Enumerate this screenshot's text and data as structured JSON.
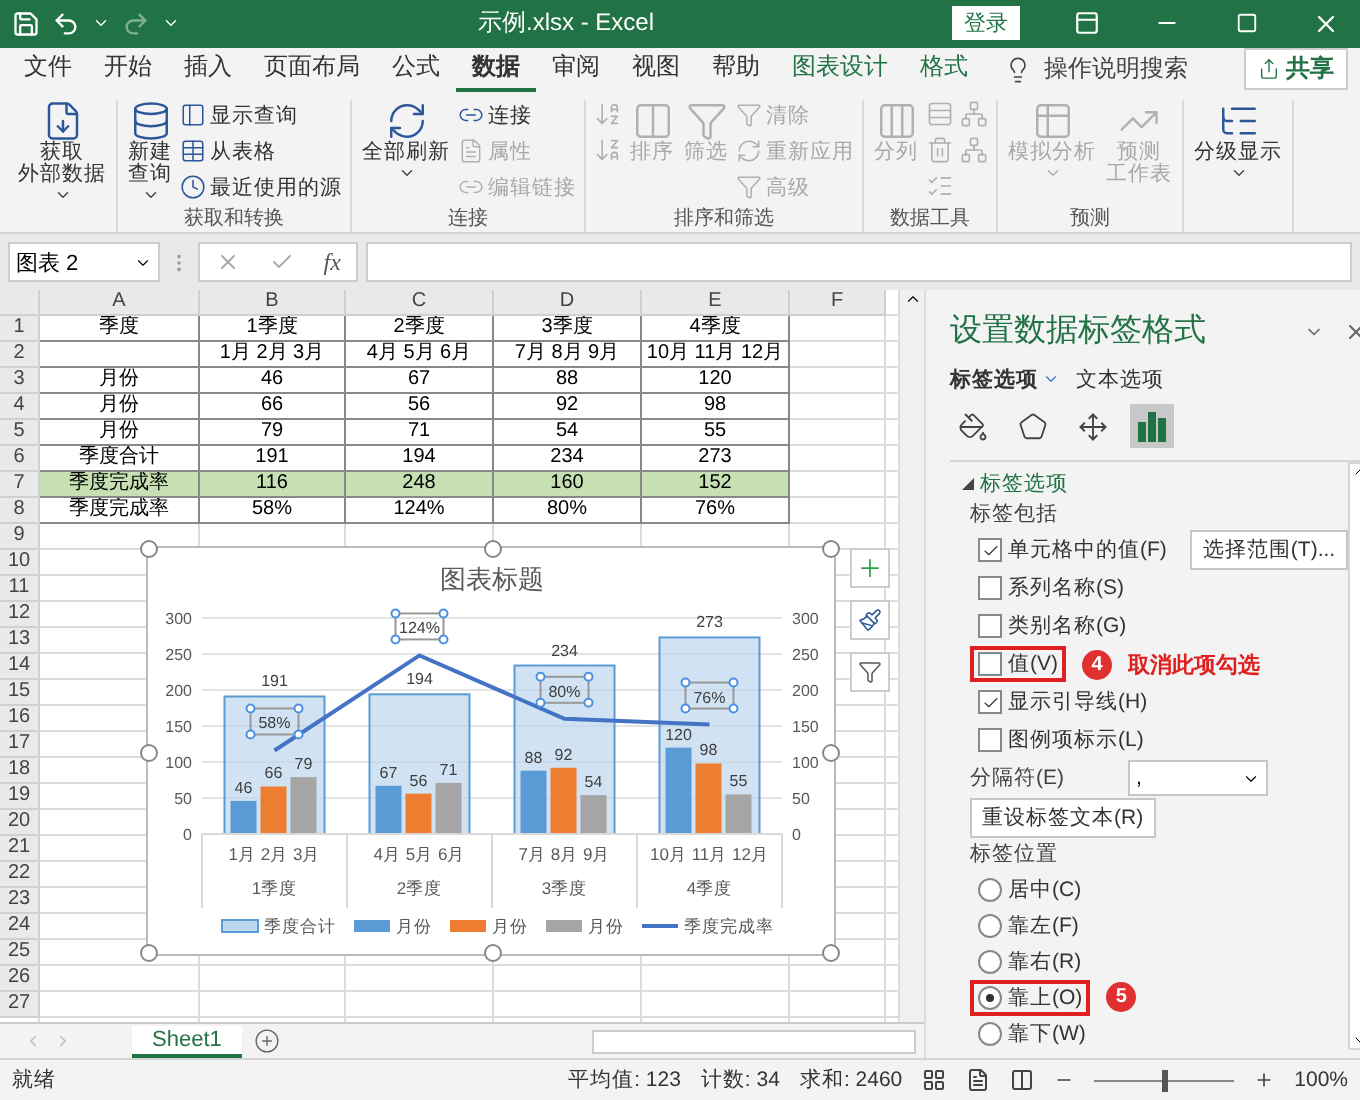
{
  "window": {
    "title": "示例.xlsx - Excel",
    "sign_in": "登录"
  },
  "ribbon_tabs": [
    {
      "label": "文件",
      "selected": false,
      "contextual": false
    },
    {
      "label": "开始",
      "selected": false,
      "contextual": false
    },
    {
      "label": "插入",
      "selected": false,
      "contextual": false
    },
    {
      "label": "页面布局",
      "selected": false,
      "contextual": false
    },
    {
      "label": "公式",
      "selected": false,
      "contextual": false
    },
    {
      "label": "数据",
      "selected": true,
      "contextual": false
    },
    {
      "label": "审阅",
      "selected": false,
      "contextual": false
    },
    {
      "label": "视图",
      "selected": false,
      "contextual": false
    },
    {
      "label": "帮助",
      "selected": false,
      "contextual": false
    },
    {
      "label": "图表设计",
      "selected": false,
      "contextual": true
    },
    {
      "label": "格式",
      "selected": false,
      "contextual": true
    }
  ],
  "tell_me": "操作说明搜索",
  "share": "共享",
  "ribbon": {
    "groups": [
      {
        "items": [
          {
            "kind": "large",
            "lines": [
              "获取",
              "外部数据"
            ],
            "dropdown": true,
            "disabled": false
          }
        ]
      },
      {
        "label": "获取和转换",
        "items": [
          {
            "kind": "large",
            "lines": [
              "新建",
              "查询"
            ],
            "dropdown": true,
            "disabled": false
          },
          {
            "kind": "stack",
            "items": [
              {
                "kind": "small",
                "label": "显示查询",
                "disabled": false
              },
              {
                "kind": "small",
                "label": "从表格",
                "disabled": false
              },
              {
                "kind": "small",
                "label": "最近使用的源",
                "disabled": false
              }
            ]
          }
        ]
      },
      {
        "label": "连接",
        "items": [
          {
            "kind": "large",
            "lines": [
              "全部刷新"
            ],
            "dropdown": true,
            "disabled": false
          },
          {
            "kind": "stack",
            "items": [
              {
                "kind": "small",
                "label": "连接",
                "disabled": false
              },
              {
                "kind": "small",
                "label": "属性",
                "disabled": true
              },
              {
                "kind": "small",
                "label": "编辑链接",
                "disabled": true
              }
            ]
          }
        ]
      },
      {
        "label": "排序和筛选",
        "items": [
          {
            "kind": "stack",
            "items": [
              {
                "kind": "icon",
                "disabled": true
              },
              {
                "kind": "icon",
                "disabled": true
              }
            ]
          },
          {
            "kind": "large",
            "lines": [
              "排序"
            ],
            "dropdown": false,
            "disabled": true
          },
          {
            "kind": "large",
            "lines": [
              "筛选"
            ],
            "dropdown": false,
            "disabled": true
          },
          {
            "kind": "stack",
            "items": [
              {
                "kind": "small",
                "label": "清除",
                "disabled": true
              },
              {
                "kind": "small",
                "label": "重新应用",
                "disabled": true
              },
              {
                "kind": "small",
                "label": "高级",
                "disabled": true
              }
            ]
          }
        ]
      },
      {
        "label": "数据工具",
        "items": [
          {
            "kind": "large",
            "lines": [
              "分列"
            ],
            "dropdown": false,
            "disabled": true
          },
          {
            "kind": "stack",
            "items": [
              {
                "kind": "icon",
                "disabled": true
              },
              {
                "kind": "icon",
                "disabled": true
              },
              {
                "kind": "icon",
                "disabled": true
              }
            ]
          },
          {
            "kind": "stack",
            "items": [
              {
                "kind": "icon",
                "disabled": true
              },
              {
                "kind": "icon",
                "disabled": true
              }
            ]
          }
        ]
      },
      {
        "label": "预测",
        "items": [
          {
            "kind": "large",
            "lines": [
              "模拟分析"
            ],
            "dropdown": true,
            "disabled": true
          },
          {
            "kind": "large",
            "lines": [
              "预测",
              "工作表"
            ],
            "dropdown": false,
            "disabled": true
          }
        ]
      },
      {
        "items": [
          {
            "kind": "large",
            "lines": [
              "分级显示"
            ],
            "dropdown": true,
            "disabled": false
          }
        ]
      }
    ]
  },
  "formula_bar": {
    "name_box": "图表 2",
    "function_label": "fx"
  },
  "sheet": {
    "columns": [
      "A",
      "B",
      "C",
      "D",
      "E",
      "F"
    ],
    "rows": [
      {
        "number": "1",
        "cells": [
          "季度",
          "1季度",
          "2季度",
          "3季度",
          "4季度"
        ],
        "highlighted": false
      },
      {
        "number": "2",
        "cells": [
          null,
          "1月 2月 3月",
          "4月 5月 6月",
          "7月 8月 9月",
          "10月 11月 12月"
        ],
        "highlighted": false
      },
      {
        "number": "3",
        "cells": [
          "月份",
          "46",
          "67",
          "88",
          "120"
        ],
        "highlighted": false
      },
      {
        "number": "4",
        "cells": [
          "月份",
          "66",
          "56",
          "92",
          "98"
        ],
        "highlighted": false
      },
      {
        "number": "5",
        "cells": [
          "月份",
          "79",
          "71",
          "54",
          "55"
        ],
        "highlighted": false
      },
      {
        "number": "6",
        "cells": [
          "季度合计",
          "191",
          "194",
          "234",
          "273"
        ],
        "highlighted": false
      },
      {
        "number": "7",
        "cells": [
          "季度完成率",
          "116",
          "248",
          "160",
          "152"
        ],
        "highlighted": true
      },
      {
        "number": "8",
        "cells": [
          "季度完成率",
          "58%",
          "124%",
          "80%",
          "76%"
        ],
        "highlighted": false
      }
    ],
    "empty_rows": [
      "9",
      "10",
      "11",
      "12",
      "13",
      "14",
      "15",
      "16",
      "17",
      "18",
      "19",
      "20",
      "21",
      "22",
      "23",
      "24",
      "25",
      "26",
      "27"
    ],
    "chart": {
      "category_groups": [
        "1季度",
        "2季度",
        "3季度",
        "4季度"
      ],
      "secondary_ticks": [
        "300",
        "250",
        "200",
        "150",
        "100",
        "50",
        "0"
      ],
      "labels_selected": true,
      "chart_data": {
        "type": "bar",
        "title": "图表标题",
        "categories": [
          "1月 2月 3月",
          "4月 5月 6月",
          "7月 8月 9月",
          "10月 11月 12月"
        ],
        "ylim": [
          0,
          300
        ],
        "yticks": [
          0,
          50,
          100,
          150,
          200,
          250,
          300
        ],
        "grid": true,
        "legend": true,
        "series": [
          {
            "name": "季度合计",
            "type": "bar",
            "color": "#bdd7ee",
            "values": [
              191,
              194,
              234,
              273
            ],
            "value_labels": [
              "191",
              "194",
              "234",
              "273"
            ]
          },
          {
            "name": "月份",
            "type": "bar",
            "color": "#5b9bd5",
            "values": [
              46,
              67,
              88,
              120
            ],
            "value_labels": [
              "46",
              "67",
              "88",
              "120"
            ]
          },
          {
            "name": "月份",
            "type": "bar",
            "color": "#ed7d31",
            "values": [
              66,
              56,
              92,
              98
            ],
            "value_labels": [
              "66",
              "56",
              "92",
              "98"
            ]
          },
          {
            "name": "月份",
            "type": "bar",
            "color": "#a5a5a5",
            "values": [
              79,
              71,
              54,
              55
            ],
            "value_labels": [
              "79",
              "71",
              "54",
              "55"
            ]
          },
          {
            "name": "季度完成率",
            "type": "line",
            "color": "#4472c4",
            "values": [
              116,
              248,
              160,
              152
            ],
            "value_labels": [
              null,
              null,
              null,
              null
            ]
          }
        ],
        "annotations": [
          {
            "text": "58%",
            "x": "1月 2月 3月",
            "y": 116
          },
          {
            "text": "124%",
            "x": "4月 5月 6月",
            "y": 248
          },
          {
            "text": "80%",
            "x": "7月 8月 9月",
            "y": 160
          },
          {
            "text": "76%",
            "x": "10月 11月 12月",
            "y": 152
          }
        ]
      }
    }
  },
  "sheet_tabs": [
    {
      "label": "Sheet1",
      "selected": true
    }
  ],
  "format_pane": {
    "title": "设置数据标签格式",
    "tabs": [
      {
        "label": "标签选项",
        "selected": true
      },
      {
        "label": "文本选项",
        "selected": false
      }
    ],
    "icon_tabs": [
      {
        "kind": "fill",
        "selected": false
      },
      {
        "kind": "effects",
        "selected": false
      },
      {
        "kind": "size",
        "selected": false
      },
      {
        "kind": "options",
        "selected": true
      }
    ],
    "section": {
      "label": "标签选项",
      "expanded": true
    },
    "include_label": "标签包括",
    "options": [
      {
        "label": "单元格中的值(F)",
        "checked": true,
        "button": "选择范围(T)..."
      },
      {
        "label": "系列名称(S)",
        "checked": false
      },
      {
        "label": "类别名称(G)",
        "checked": false
      },
      {
        "label": "值(V)",
        "checked": false,
        "callout": {
          "number": "4",
          "text": "取消此项勾选"
        }
      },
      {
        "label": "显示引导线(H)",
        "checked": true
      },
      {
        "label": "图例项标示(L)",
        "checked": false
      }
    ],
    "separator": {
      "label": "分隔符(E)",
      "value": ","
    },
    "reset_button": "重设标签文本(R)",
    "position_label": "标签位置",
    "positions": [
      {
        "label": "居中(C)",
        "selected": false
      },
      {
        "label": "靠左(F)",
        "selected": false
      },
      {
        "label": "靠右(R)",
        "selected": false
      },
      {
        "label": "靠上(O)",
        "selected": true,
        "callout": {
          "number": "5"
        }
      },
      {
        "label": "靠下(W)",
        "selected": false
      }
    ]
  },
  "status_bar": {
    "status": "就绪",
    "stats": [
      "平均值: 123",
      "计数: 34",
      "求和: 2460"
    ],
    "zoom": {
      "level": 0.5,
      "reading": "100%"
    }
  }
}
